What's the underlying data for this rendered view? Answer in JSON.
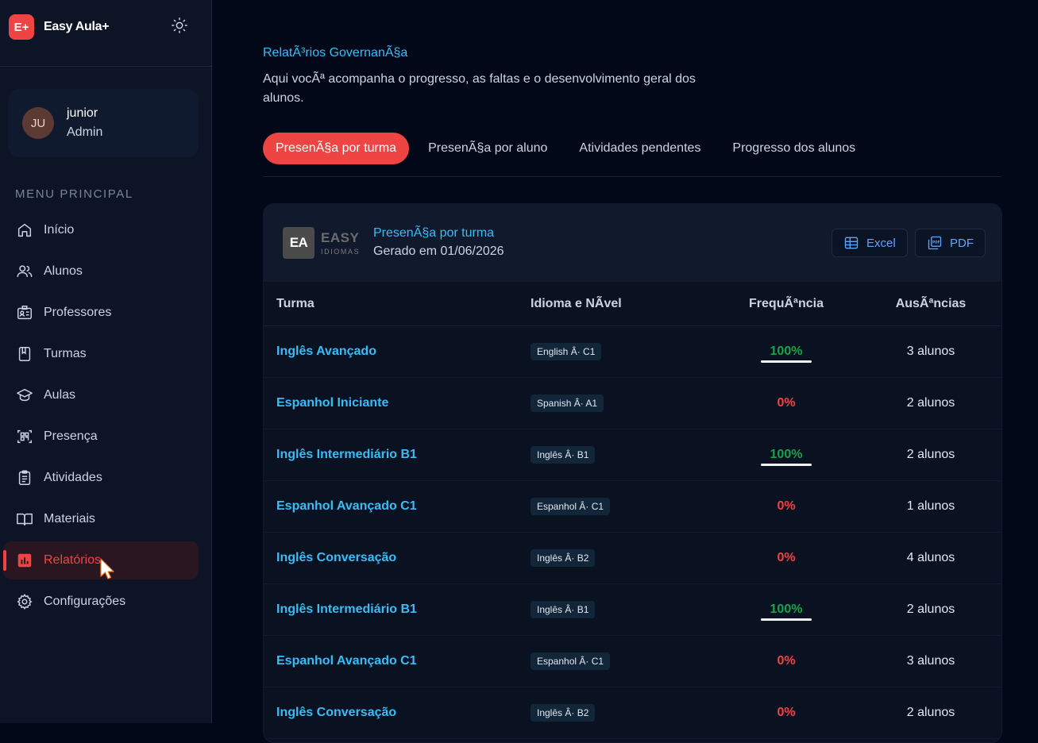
{
  "app": {
    "logo_text": "E+",
    "name": "Easy Aula+"
  },
  "user": {
    "initials": "JU",
    "name": "junior",
    "role": "Admin"
  },
  "sidebar": {
    "section_title": "MENU PRINCIPAL",
    "items": [
      {
        "label": "Início",
        "icon": "home-icon"
      },
      {
        "label": "Alunos",
        "icon": "users-icon"
      },
      {
        "label": "Professores",
        "icon": "id-card-icon"
      },
      {
        "label": "Turmas",
        "icon": "book-icon"
      },
      {
        "label": "Aulas",
        "icon": "graduation-cap-icon"
      },
      {
        "label": "Presença",
        "icon": "qr-code-icon"
      },
      {
        "label": "Atividades",
        "icon": "clipboard-icon"
      },
      {
        "label": "Materiais",
        "icon": "open-book-icon"
      },
      {
        "label": "Relatórios",
        "icon": "bar-chart-icon",
        "active": true
      },
      {
        "label": "Configurações",
        "icon": "gear-icon"
      }
    ]
  },
  "page": {
    "title": "RelatÃ³rios GovernanÃ§a",
    "description": "Aqui vocÃª acompanha o progresso, as faltas e o desenvolvimento geral dos alunos."
  },
  "tabs": [
    {
      "label": "PresenÃ§a por turma",
      "active": true
    },
    {
      "label": "PresenÃ§a por aluno"
    },
    {
      "label": "Atividades pendentes"
    },
    {
      "label": "Progresso dos alunos"
    }
  ],
  "report": {
    "logo_box": "EA",
    "logo_name": "EASY",
    "logo_sub": "IDIOMAS",
    "title": "PresenÃ§a por turma",
    "generated": "Gerado em 01/06/2026",
    "excel_label": "Excel",
    "pdf_label": "PDF"
  },
  "table": {
    "headers": [
      "Turma",
      "Idioma e NÃvel",
      "FrequÃªncia",
      "AusÃªncias"
    ],
    "rows": [
      {
        "turma": "Inglês Avançado",
        "idioma": "English Â· C1",
        "freq": "100%",
        "freq_value": 1.0,
        "ausencias": "3 alunos"
      },
      {
        "turma": "Espanhol Iniciante",
        "idioma": "Spanish Â· A1",
        "freq": "0%",
        "freq_value": 0.0,
        "ausencias": "2 alunos"
      },
      {
        "turma": "Inglês Intermediário B1",
        "idioma": "Inglês Â· B1",
        "freq": "100%",
        "freq_value": 1.0,
        "ausencias": "2 alunos"
      },
      {
        "turma": "Espanhol Avançado C1",
        "idioma": "Espanhol Â· C1",
        "freq": "0%",
        "freq_value": 0.0,
        "ausencias": "1 alunos"
      },
      {
        "turma": "Inglês Conversação",
        "idioma": "Inglês Â· B2",
        "freq": "0%",
        "freq_value": 0.0,
        "ausencias": "4 alunos"
      },
      {
        "turma": "Inglês Intermediário B1",
        "idioma": "Inglês Â· B1",
        "freq": "100%",
        "freq_value": 1.0,
        "ausencias": "2 alunos"
      },
      {
        "turma": "Espanhol Avançado C1",
        "idioma": "Espanhol Â· C1",
        "freq": "0%",
        "freq_value": 0.0,
        "ausencias": "3 alunos"
      },
      {
        "turma": "Inglês Conversação",
        "idioma": "Inglês Â· B2",
        "freq": "0%",
        "freq_value": 0.0,
        "ausencias": "2 alunos"
      }
    ]
  },
  "colors": {
    "accent": "#ef4444",
    "link": "#38bdf8",
    "ok": "#16a34a"
  }
}
